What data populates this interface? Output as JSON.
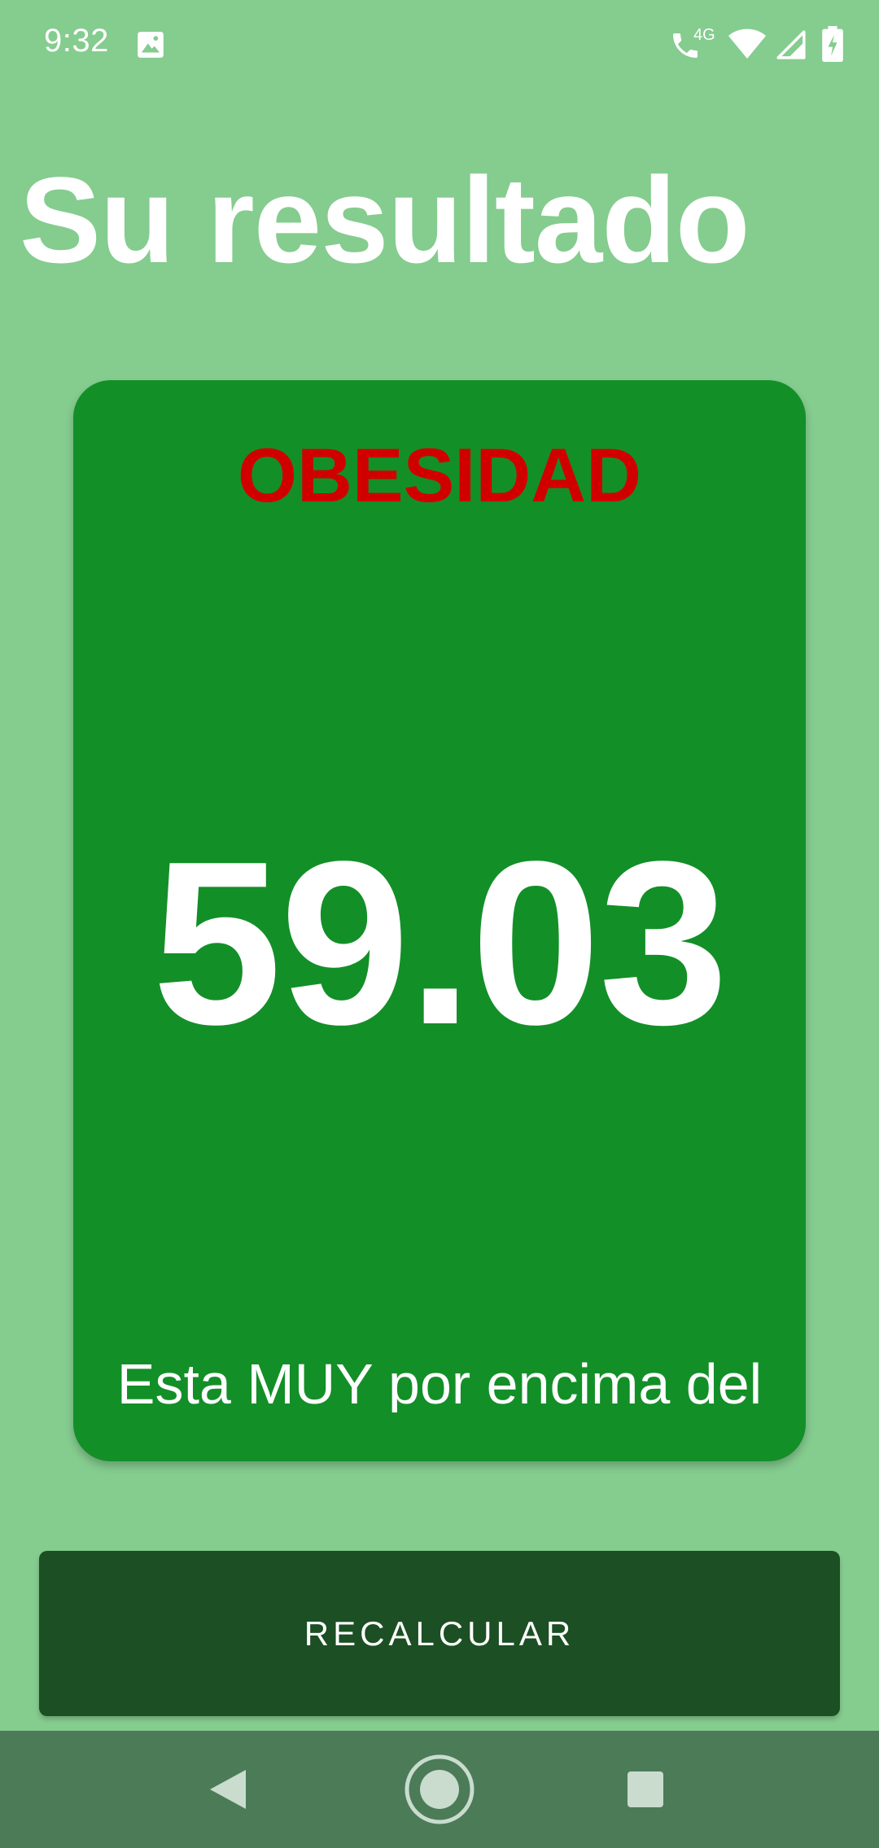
{
  "status_bar": {
    "time": "9:32",
    "network_label": "4G",
    "icons": [
      "image-icon",
      "wifi-call-icon",
      "wifi-icon",
      "cell-signal-icon",
      "battery-charging-icon"
    ]
  },
  "header": {
    "title": "Su resultado"
  },
  "result": {
    "category": "OBESIDAD",
    "value": "59.03",
    "message": "Esta MUY por encima del"
  },
  "actions": {
    "recalculate_label": "RECALCULAR"
  },
  "nav_bar": {
    "icons": [
      "back-icon",
      "home-icon",
      "recents-icon"
    ]
  },
  "colors": {
    "background": "#85cc8f",
    "card": "#138f28",
    "category_text": "#d10000",
    "button": "#1c4f23",
    "nav_bar": "#4b7b57",
    "text": "#ffffff"
  }
}
